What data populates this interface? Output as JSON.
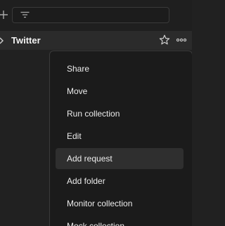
{
  "toolbar": {
    "add_icon": "plus-icon",
    "filter_icon": "filter-icon",
    "filter_value": ""
  },
  "collection": {
    "chevron_icon": "chevron-right-icon",
    "name": "Twitter",
    "star_icon": "star-icon",
    "more_icon": "more-horizontal-icon"
  },
  "menu": {
    "items": [
      {
        "label": "Share"
      },
      {
        "label": "Move"
      },
      {
        "label": "Run collection"
      },
      {
        "label": "Edit"
      },
      {
        "label": "Add request",
        "highlighted": true
      },
      {
        "label": "Add folder"
      },
      {
        "label": "Monitor collection"
      },
      {
        "label": "Mock collection"
      }
    ]
  },
  "colors": {
    "background": "#212121",
    "row_background": "#2b2b2b",
    "menu_background": "#1b1b1b",
    "menu_hover": "#2f2f2f",
    "text": "#ececec"
  }
}
